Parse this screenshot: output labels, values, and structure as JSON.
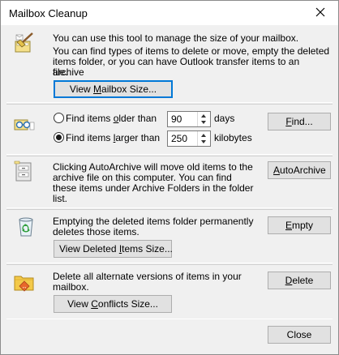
{
  "window": {
    "title": "Mailbox Cleanup"
  },
  "intro": {
    "line1": "You can use this tool to manage the size of your mailbox.",
    "line2a": "You can find types of items to delete or move, empty the deleted",
    "line2b": "items folder, or you can have Outlook transfer items to an archive",
    "line2c": "file.",
    "view_size_button": {
      "pre": "View ",
      "key": "M",
      "post": "ailbox Size..."
    }
  },
  "find": {
    "older_label": {
      "pre": "Find items ",
      "key": "o",
      "post": "lder than"
    },
    "older_value": "90",
    "older_unit": "days",
    "larger_label": {
      "pre": "Find items ",
      "key": "l",
      "post": "arger than"
    },
    "larger_value": "250",
    "larger_unit": "kilobytes",
    "selected": "larger",
    "find_button": {
      "pre": "",
      "key": "F",
      "post": "ind..."
    }
  },
  "autoarchive": {
    "line1": "Clicking AutoArchive will move old items to the",
    "line2": "archive file on this computer. You can find",
    "line3": "these items under Archive Folders in the folder",
    "line4": "list.",
    "button": {
      "pre": "",
      "key": "A",
      "post": "utoArchive"
    }
  },
  "deleted": {
    "line1": "Emptying the deleted items folder permanently",
    "line2": "deletes those items.",
    "empty_button": {
      "pre": "",
      "key": "E",
      "post": "mpty"
    },
    "view_button": {
      "pre": "View Deleted ",
      "key": "I",
      "post": "tems Size..."
    }
  },
  "conflicts": {
    "line1": "Delete all alternate versions of items in your",
    "line2": "mailbox.",
    "delete_button": {
      "pre": "",
      "key": "D",
      "post": "elete"
    },
    "view_button": {
      "pre": "View ",
      "key": "C",
      "post": "onflicts Size..."
    }
  },
  "footer": {
    "close_button": "Close"
  },
  "icons": {
    "cleanup": "mailbox-cleanup-icon",
    "find": "find-items-icon",
    "archive": "autoarchive-icon",
    "recycle": "recycle-bin-icon",
    "conflicts": "conflicts-folder-icon",
    "close": "close-icon"
  }
}
